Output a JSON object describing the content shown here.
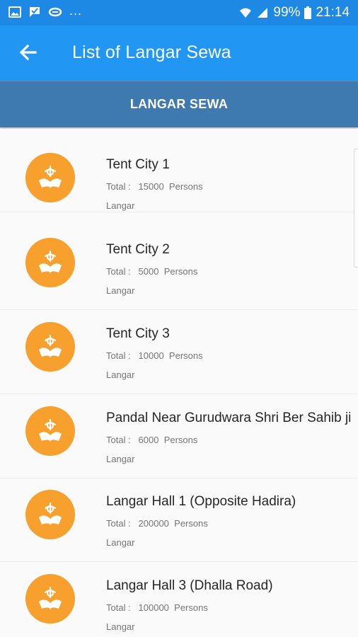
{
  "status_bar": {
    "left_icons": [
      "image-icon",
      "check-message-icon",
      "link-icon"
    ],
    "more": "...",
    "battery": "99%",
    "time": "21:14"
  },
  "app_bar": {
    "title": "List of Langar Sewa",
    "back_icon": "arrow-left-icon"
  },
  "section": {
    "title": "LANGAR SEWA"
  },
  "colors": {
    "status_bar": "#1e88e5",
    "app_bar": "#2196f3",
    "section_header": "#3e79b0",
    "avatar": "#f7a02e"
  },
  "items": [
    {
      "title": "Tent City 1",
      "total_label": "Total :",
      "total_value": "15000",
      "unit": "Persons",
      "type": "Langar"
    },
    {
      "title": "Tent City 2",
      "total_label": "Total :",
      "total_value": "5000",
      "unit": "Persons",
      "type": "Langar"
    },
    {
      "title": "Tent City 3",
      "total_label": "Total :",
      "total_value": "10000",
      "unit": "Persons",
      "type": "Langar"
    },
    {
      "title": "Pandal Near Gurudwara Shri Ber Sahib ji",
      "total_label": "Total :",
      "total_value": "6000",
      "unit": "Persons",
      "type": "Langar"
    },
    {
      "title": "Langar Hall 1 (Opposite Hadira)",
      "total_label": "Total :",
      "total_value": "200000",
      "unit": "Persons",
      "type": "Langar"
    },
    {
      "title": "Langar Hall 3 (Dhalla Road)",
      "total_label": "Total :",
      "total_value": "100000",
      "unit": "Persons",
      "type": "Langar"
    }
  ]
}
